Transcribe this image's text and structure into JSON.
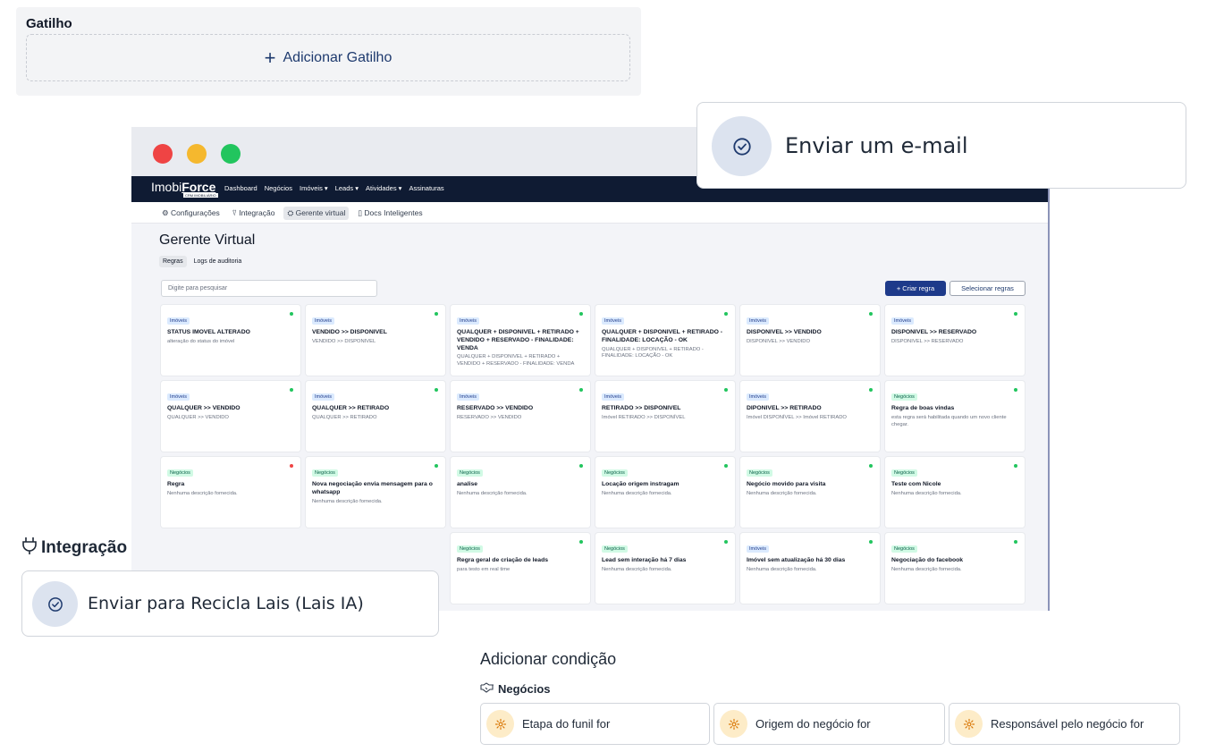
{
  "gatilho": {
    "title": "Gatilho",
    "add_label": "Adicionar Gatilho",
    "plus": "+"
  },
  "email_action": {
    "label": "Enviar um e-mail"
  },
  "integracao": {
    "title": "Integração"
  },
  "lais_action": {
    "label": "Enviar para Recicla Lais (Lais IA)"
  },
  "condicao": {
    "title": "Adicionar condição",
    "section": "Negócios",
    "options": [
      "Etapa do funil for",
      "Origem do negócio for",
      "Responsável pelo negócio for"
    ]
  },
  "app": {
    "logo_a": "Imobi",
    "logo_b": "Force",
    "logo_small": "CRM IMOBILIÁRIO",
    "nav": [
      "Dashboard",
      "Negócios",
      "Imóveis ▾",
      "Leads ▾",
      "Atividades ▾",
      "Assinaturas"
    ],
    "subnav": [
      "⚙ Configurações",
      "⍢ Integração",
      "⛭ Gerente virtual",
      "▯ Docs Inteligentes"
    ],
    "page_title": "Gerente Virtual",
    "tabs": [
      "Regras",
      "Logs de auditoria"
    ],
    "search_placeholder": "Digite para pesquisar",
    "create_label": "+ Criar regra",
    "select_label": "Selecionar regras"
  },
  "colors": {
    "active": "#22c55e",
    "inactive": "#ef4444",
    "navy": "#0f1b33"
  },
  "cards": [
    {
      "tag": "Imóveis",
      "type": "imoveis",
      "status": "active",
      "title": "STATUS IMOVEL ALTERADO",
      "desc": "alteração do status do imóvel"
    },
    {
      "tag": "Imóveis",
      "type": "imoveis",
      "status": "active",
      "title": "VENDIDO >> DISPONIVEL",
      "desc": "VENDIDO >> DISPONIVEL"
    },
    {
      "tag": "Imóveis",
      "type": "imoveis",
      "status": "active",
      "title": "QUALQUER + DISPONIVEL + RETIRADO + VENDIDO + RESERVADO - FINALIDADE: VENDA",
      "desc": "QUALQUER + DISPONIVEL + RETIRADO + VENDIDO + RESERVADO - FINALIDADE: VENDA"
    },
    {
      "tag": "Imóveis",
      "type": "imoveis",
      "status": "active",
      "title": "QUALQUER + DISPONIVEL + RETIRADO - FINALIDADE: LOCAÇÃO - OK",
      "desc": "QUALQUER + DISPONIVEL + RETIRADO - FINALIDADE: LOCAÇÃO - OK"
    },
    {
      "tag": "Imóveis",
      "type": "imoveis",
      "status": "active",
      "title": "DISPONIVEL >> VENDIDO",
      "desc": "DISPONIVEL >> VENDIDO"
    },
    {
      "tag": "Imóveis",
      "type": "imoveis",
      "status": "active",
      "title": "DISPONIVEL >> RESERVADO",
      "desc": "DISPONIVEL >> RESERVADO"
    },
    {
      "tag": "Imóveis",
      "type": "imoveis",
      "status": "active",
      "title": "QUALQUER >> VENDIDO",
      "desc": "QUALQUER >> VENDIDO"
    },
    {
      "tag": "Imóveis",
      "type": "imoveis",
      "status": "active",
      "title": "QUALQUER >> RETIRADO",
      "desc": "QUALQUER >> RETIRADO"
    },
    {
      "tag": "Imóveis",
      "type": "imoveis",
      "status": "active",
      "title": "RESERVADO >> VENDIDO",
      "desc": "RESERVADO >> VENDIDO"
    },
    {
      "tag": "Imóveis",
      "type": "imoveis",
      "status": "active",
      "title": "RETIRADO >> DISPONIVEL",
      "desc": "Imóvel RETIRADO >> DISPONÍVEL"
    },
    {
      "tag": "Imóveis",
      "type": "imoveis",
      "status": "active",
      "title": "DIPONIVEL >> RETIRADO",
      "desc": "Imóvel DISPONÍVEL >> Imóvel RETIRADO"
    },
    {
      "tag": "Negócios",
      "type": "negocios",
      "status": "active",
      "title": "Regra de boas vindas",
      "desc": "esta regra será habilitada quando um novo cliente chegar."
    },
    {
      "tag": "Negócios",
      "type": "negocios",
      "status": "inactive",
      "title": "Regra",
      "desc": "Nenhuma descrição fornecida."
    },
    {
      "tag": "Negócios",
      "type": "negocios",
      "status": "active",
      "title": "Nova negociação envia mensagem para o whatsapp",
      "desc": "Nenhuma descrição fornecida."
    },
    {
      "tag": "Negócios",
      "type": "negocios",
      "status": "active",
      "title": "analise",
      "desc": "Nenhuma descrição fornecida."
    },
    {
      "tag": "Negócios",
      "type": "negocios",
      "status": "active",
      "title": "Locação origem instragam",
      "desc": "Nenhuma descrição fornecida."
    },
    {
      "tag": "Negócios",
      "type": "negocios",
      "status": "active",
      "title": "Negócio movido para visita",
      "desc": "Nenhuma descrição fornecida."
    },
    {
      "tag": "Negócios",
      "type": "negocios",
      "status": "active",
      "title": "Teste com Nicole",
      "desc": "Nenhuma descrição fornecida."
    },
    {
      "tag": "Negócios",
      "type": "negocios",
      "status": "active",
      "title": "Regra geral de criação de leads",
      "desc": "para testo em real time"
    },
    {
      "tag": "Negócios",
      "type": "negocios",
      "status": "active",
      "title": "Lead sem interação há 7 dias",
      "desc": "Nenhuma descrição fornecida."
    },
    {
      "tag": "Imóveis",
      "type": "imoveis",
      "status": "active",
      "title": "Imóvel sem atualização há 30 dias",
      "desc": "Nenhuma descrição fornecida."
    },
    {
      "tag": "Negócios",
      "type": "negocios",
      "status": "active",
      "title": "Negociação do facebook",
      "desc": "Nenhuma descrição fornecida."
    }
  ]
}
